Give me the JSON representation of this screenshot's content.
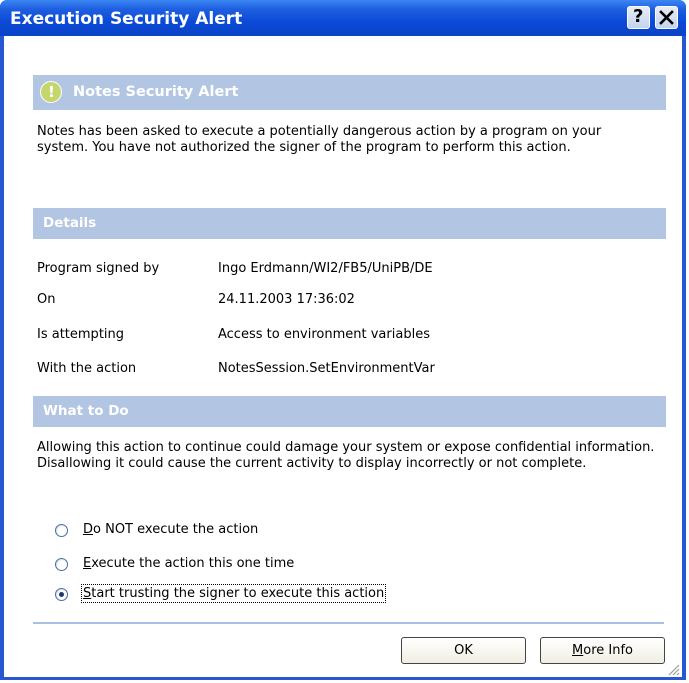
{
  "window": {
    "title": "Execution Security Alert",
    "help_label": "?"
  },
  "alert": {
    "header": "Notes Security Alert",
    "icon_glyph": "!",
    "message": "Notes has been asked to execute a potentially dangerous action by a program on your system.  You have not authorized the signer of the program to perform this action."
  },
  "details": {
    "header": "Details",
    "rows": [
      {
        "label": "Program signed by",
        "value": "Ingo Erdmann/WI2/FB5/UniPB/DE"
      },
      {
        "label": "On",
        "value": "24.11.2003 17:36:02"
      },
      {
        "label": "Is attempting",
        "value": "Access to environment variables"
      },
      {
        "label": "With the action",
        "value": "NotesSession.SetEnvironmentVar"
      }
    ]
  },
  "what_to_do": {
    "header": "What to Do",
    "message": "Allowing this action to continue could damage your system or expose confidential information. Disallowing it could cause the current activity to display incorrectly or not complete.",
    "options": [
      {
        "mnemonic": "D",
        "rest": "o NOT execute the action",
        "selected": false
      },
      {
        "mnemonic": "E",
        "rest": "xecute the action this one time",
        "selected": false
      },
      {
        "mnemonic": "S",
        "rest": "tart trusting the signer to execute this action",
        "selected": true
      }
    ]
  },
  "buttons": {
    "ok": "OK",
    "more_mnemonic": "M",
    "more_rest": "ore Info"
  },
  "colors": {
    "titlebar": "#0b4ad8",
    "section_header": "#b2c6e4",
    "alert_icon": "#c6d66e"
  },
  "icons": [
    "alert-exclamation-icon",
    "help-icon",
    "close-icon",
    "resize-grip-icon"
  ]
}
